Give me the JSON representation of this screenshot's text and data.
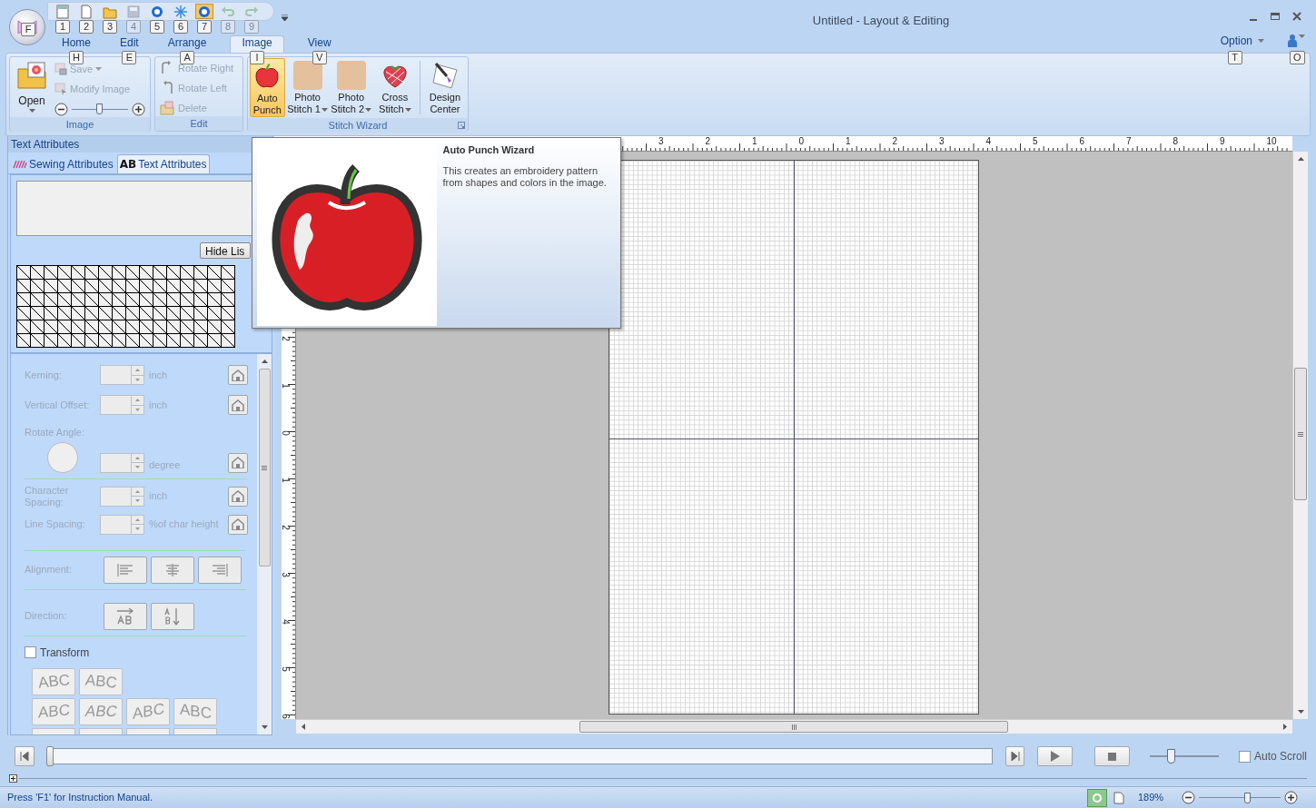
{
  "app_button": {
    "keytip": "F"
  },
  "quick_access": [
    {
      "kind": "new",
      "keytip": "1",
      "disabled": false,
      "selected": false
    },
    {
      "kind": "page",
      "keytip": "2",
      "disabled": false,
      "selected": false
    },
    {
      "kind": "open",
      "keytip": "3",
      "disabled": false,
      "selected": false
    },
    {
      "kind": "save",
      "keytip": "4",
      "disabled": true,
      "selected": false
    },
    {
      "kind": "send",
      "keytip": "5",
      "disabled": false,
      "selected": false
    },
    {
      "kind": "sparkle",
      "keytip": "6",
      "disabled": false,
      "selected": false
    },
    {
      "kind": "send",
      "keytip": "7",
      "disabled": false,
      "selected": true
    },
    {
      "kind": "undo",
      "keytip": "8",
      "disabled": true,
      "selected": false
    },
    {
      "kind": "redo",
      "keytip": "9",
      "disabled": true,
      "selected": false
    }
  ],
  "window": {
    "title": "Untitled - Layout & Editing"
  },
  "ribbon_tabs": [
    {
      "label": "Home",
      "keytip": "H",
      "selected": false
    },
    {
      "label": "Edit",
      "keytip": "E",
      "selected": false
    },
    {
      "label": "Arrange",
      "keytip": "A",
      "selected": false
    },
    {
      "label": "Image",
      "keytip": "I",
      "selected": true
    },
    {
      "label": "View",
      "keytip": "V",
      "selected": false
    }
  ],
  "option_menu": {
    "label": "Option",
    "keytip": "T"
  },
  "account_menu": {
    "keytip": "O"
  },
  "image_group": {
    "title": "Image",
    "open_label": "Open",
    "save": {
      "label": "Save",
      "disabled": true
    },
    "modify": {
      "label": "Modify Image",
      "disabled": true
    },
    "zoom_slider": {
      "level": 0.5
    }
  },
  "edit_group": {
    "title": "Edit",
    "items": [
      {
        "kind": "rotate_right",
        "label": "Rotate Right",
        "disabled": true
      },
      {
        "kind": "rotate_left",
        "label": "Rotate Left",
        "disabled": true
      },
      {
        "kind": "delete",
        "label": "Delete",
        "disabled": true
      }
    ]
  },
  "stitch_wizard_group": {
    "title": "Stitch Wizard",
    "items": [
      {
        "kind": "apple",
        "lines": [
          "Auto",
          "Punch"
        ],
        "dropdown": false,
        "selected": true
      },
      {
        "kind": "photo",
        "lines": [
          "Photo",
          "Stitch 1"
        ],
        "dropdown": true,
        "selected": false
      },
      {
        "kind": "photo",
        "lines": [
          "Photo",
          "Stitch 2"
        ],
        "dropdown": true,
        "selected": false
      },
      {
        "kind": "cross",
        "lines": [
          "Cross",
          "Stitch"
        ],
        "dropdown": true,
        "selected": false
      },
      {
        "kind": "design",
        "lines": [
          "Design",
          "Center"
        ],
        "dropdown": false,
        "selected": false
      }
    ]
  },
  "side_panel": {
    "title": "Text Attributes",
    "tabs": [
      {
        "kind": "sewing",
        "label": "Sewing Attributes",
        "selected": false
      },
      {
        "kind": "text",
        "icon_text": "AB",
        "label": "Text Attributes",
        "selected": true
      }
    ],
    "hide_list_button": "Hide Lis",
    "disabled": true,
    "rows": [
      {
        "kind": "spin",
        "label": "Kerning:",
        "unit": "inch"
      },
      {
        "kind": "spin",
        "label": "Vertical Offset:",
        "unit": "inch"
      },
      {
        "kind": "dial",
        "label": "Rotate Angle:",
        "unit": "degree"
      },
      {
        "kind": "spin2",
        "label": "Character Spacing:",
        "unit": "inch"
      },
      {
        "kind": "spin",
        "label": "Line Spacing:",
        "unit": "%of char height"
      },
      {
        "kind": "align",
        "label": "Alignment:"
      },
      {
        "kind": "direction",
        "label": "Direction:"
      }
    ],
    "transform": {
      "label": "Transform",
      "checked": false
    },
    "transform_styles": [
      "ABC",
      "ABC",
      "ABC",
      "ABC",
      "ABC",
      "ABC"
    ]
  },
  "top_ruler": {
    "labels": [
      "3",
      "2",
      "1",
      "0",
      "1",
      "2",
      "3",
      "4",
      "5",
      "6",
      "7",
      "8",
      "9",
      "10"
    ]
  },
  "left_ruler": {
    "labels": [
      "2",
      "1",
      "0",
      "1",
      "2",
      "3",
      "4",
      "5",
      "6"
    ]
  },
  "tooltip": {
    "title": "Auto Punch Wizard",
    "text": "This creates an embroidery pattern from shapes and colors in the image."
  },
  "playback": {
    "position": {
      "level": 0
    },
    "speed": {
      "level": 0.3
    },
    "auto_scroll": {
      "label": "Auto Scroll",
      "checked": false
    }
  },
  "status_bar": {
    "message": "Press 'F1' for Instruction Manual.",
    "zoom": "189%",
    "zoom_slider": {
      "level": 0.6
    }
  }
}
